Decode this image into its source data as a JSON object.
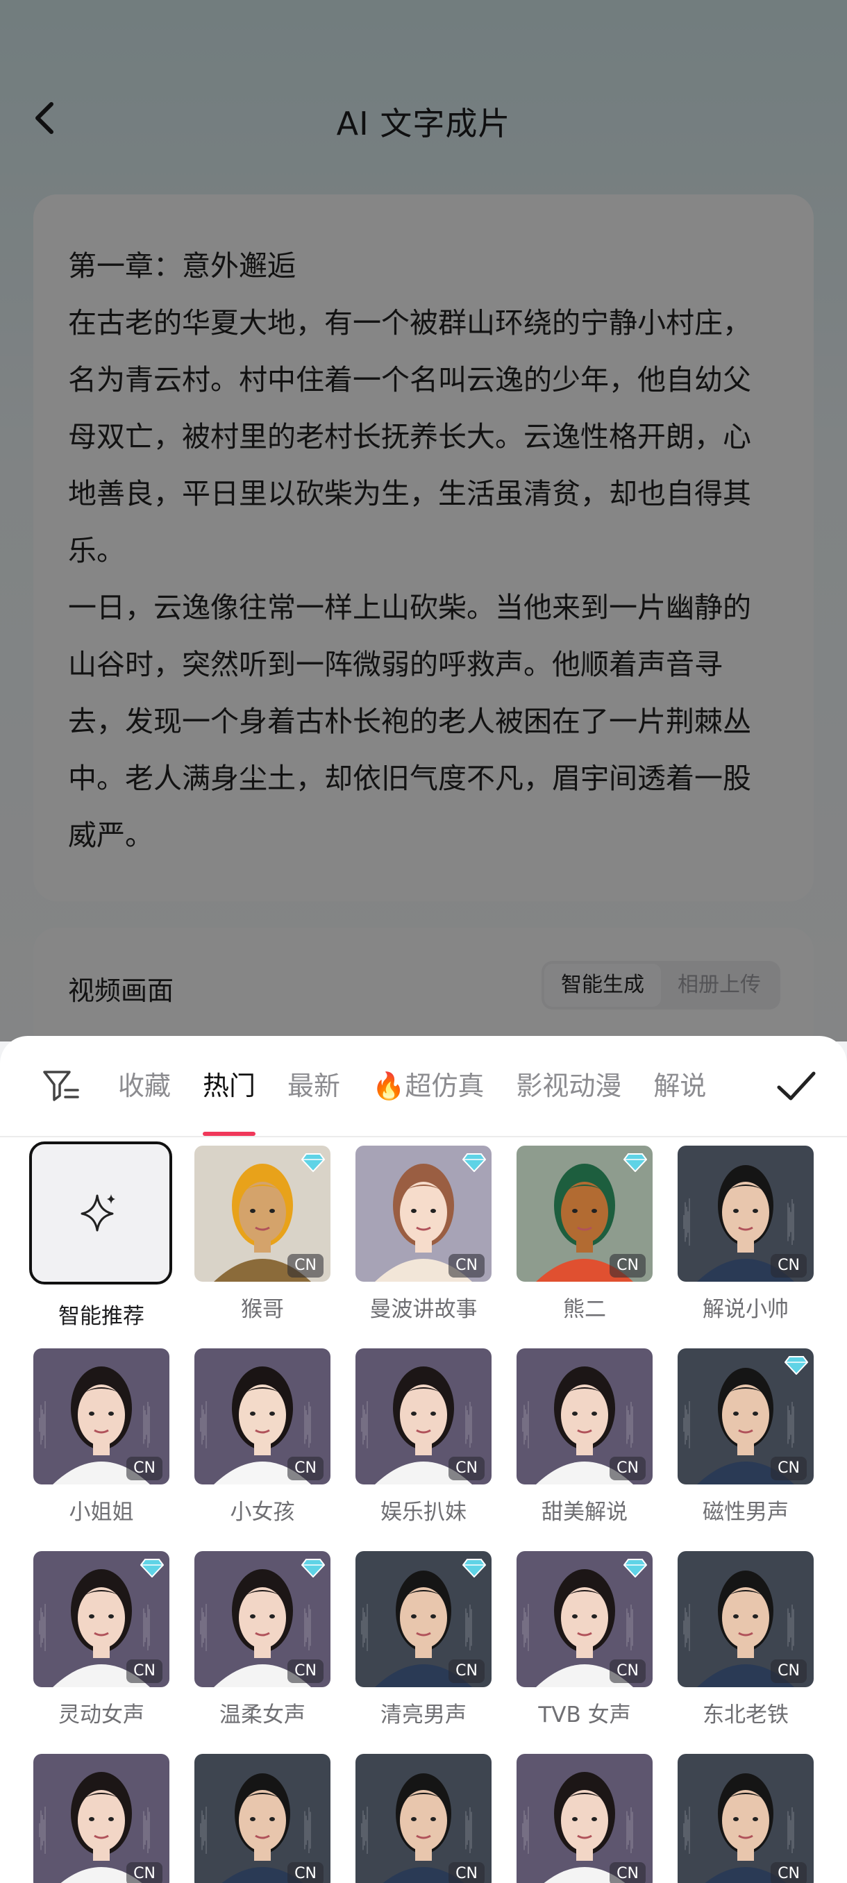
{
  "header": {
    "title": "AI 文字成片"
  },
  "story": {
    "text": "第一章：意外邂逅\n在古老的华夏大地，有一个被群山环绕的宁静小村庄，名为青云村。村中住着一个名叫云逸的少年，他自幼父母双亡，被村里的老村长抚养长大。云逸性格开朗，心地善良，平日里以砍柴为生，生活虽清贫，却也自得其乐。\n一日，云逸像往常一样上山砍柴。当他来到一片幽静的山谷时，突然听到一阵微弱的呼救声。他顺着声音寻去，发现一个身着古朴长袍的老人被困在了一片荆棘丛中。老人满身尘土，却依旧气度不凡，眉宇间透着一股威严。\n云逸毫不犹豫地钻进荆棘丛，将老人救了出来。"
  },
  "video": {
    "label": "视频画面",
    "options": [
      "智能生成",
      "相册上传"
    ],
    "selected": "智能生成"
  },
  "voice_sheet": {
    "tabs": [
      "收藏",
      "热门",
      "最新",
      "超仿真",
      "影视动漫",
      "解说"
    ],
    "active_tab": "热门",
    "fire_tab": "超仿真",
    "lang_badge": "CN",
    "recommend_label": "智能推荐",
    "voices": [
      {
        "name": "猴哥",
        "vip": true,
        "kind": "monkey"
      },
      {
        "name": "曼波讲故事",
        "vip": true,
        "kind": "girl-toon"
      },
      {
        "name": "熊二",
        "vip": true,
        "kind": "bear"
      },
      {
        "name": "解说小帅",
        "vip": false,
        "kind": "man"
      },
      {
        "name": "小姐姐",
        "vip": false,
        "kind": "woman"
      },
      {
        "name": "小女孩",
        "vip": false,
        "kind": "girl"
      },
      {
        "name": "娱乐扒妹",
        "vip": false,
        "kind": "woman"
      },
      {
        "name": "甜美解说",
        "vip": false,
        "kind": "woman"
      },
      {
        "name": "磁性男声",
        "vip": true,
        "kind": "man"
      },
      {
        "name": "灵动女声",
        "vip": true,
        "kind": "woman"
      },
      {
        "name": "温柔女声",
        "vip": true,
        "kind": "woman"
      },
      {
        "name": "清亮男声",
        "vip": true,
        "kind": "man"
      },
      {
        "name": "TVB 女声",
        "vip": true,
        "kind": "woman"
      },
      {
        "name": "东北老铁",
        "vip": false,
        "kind": "man"
      },
      {
        "name": "",
        "vip": false,
        "kind": "woman"
      },
      {
        "name": "",
        "vip": false,
        "kind": "man"
      },
      {
        "name": "",
        "vip": false,
        "kind": "man"
      },
      {
        "name": "",
        "vip": false,
        "kind": "woman"
      },
      {
        "name": "",
        "vip": false,
        "kind": "man"
      }
    ]
  },
  "colors": {
    "accent": "#f0385a",
    "vip": "#5fd3e6",
    "avatar_bg": "#5c5570"
  }
}
